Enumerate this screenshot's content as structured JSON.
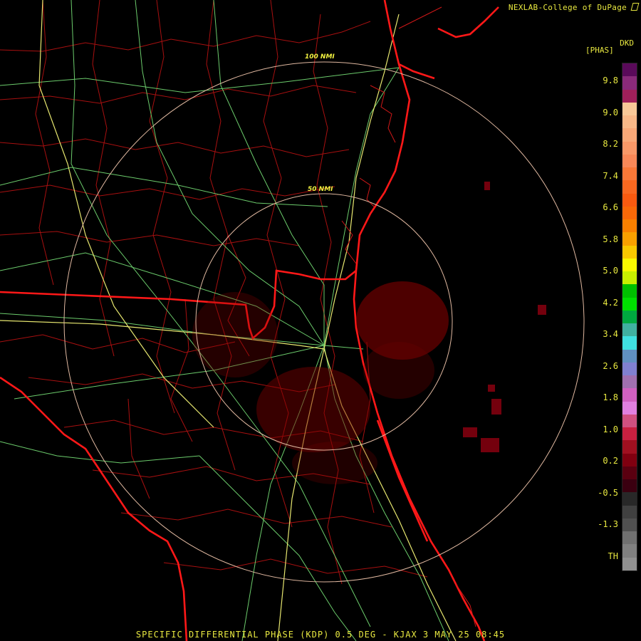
{
  "credit": "NEXLAB-College of DuPage",
  "credit_icon": "cursor-arrow-icon",
  "colorbar": {
    "product_code": "DKD",
    "units": "[PHAS]",
    "labels": [
      "9.8",
      "9.0",
      "8.2",
      "7.4",
      "6.6",
      "5.8",
      "5.0",
      "4.2",
      "3.4",
      "2.6",
      "1.8",
      "1.0",
      "0.2",
      "-0.5",
      "-1.3",
      "TH"
    ],
    "colors_top_to_bottom": [
      "#5a0a5a",
      "#8a2a7a",
      "#a0205a",
      "#f8c898",
      "#f8b888",
      "#f8a878",
      "#f89868",
      "#f88858",
      "#f87838",
      "#f86820",
      "#f85a10",
      "#f86808",
      "#f88000",
      "#f8a000",
      "#f8c800",
      "#f8f800",
      "#c8f000",
      "#00c000",
      "#00e000",
      "#00a840",
      "#40b0a0",
      "#40e0e0",
      "#6090c0",
      "#8080d0",
      "#a070b0",
      "#d060c0",
      "#e080e0",
      "#d05080",
      "#c82040",
      "#a01020",
      "#800010",
      "#5a0010",
      "#3a0010",
      "#282828",
      "#404040",
      "#505050",
      "#707070",
      "#808080",
      "#909090"
    ]
  },
  "ring_labels": {
    "inner": "50 NMI",
    "outer": "100 NMI"
  },
  "colors": {
    "state_border": "#ff1818",
    "county_border": "#b01010",
    "highway": "#70d070",
    "interstate": "#e0e070",
    "range_ring": "#e0b8a0",
    "echo": "#8a0000"
  },
  "footer": "SPECIFIC DIFFERENTIAL PHASE (KDP) 0.5 DEG - KJAX 3 MAY 25 08:45"
}
